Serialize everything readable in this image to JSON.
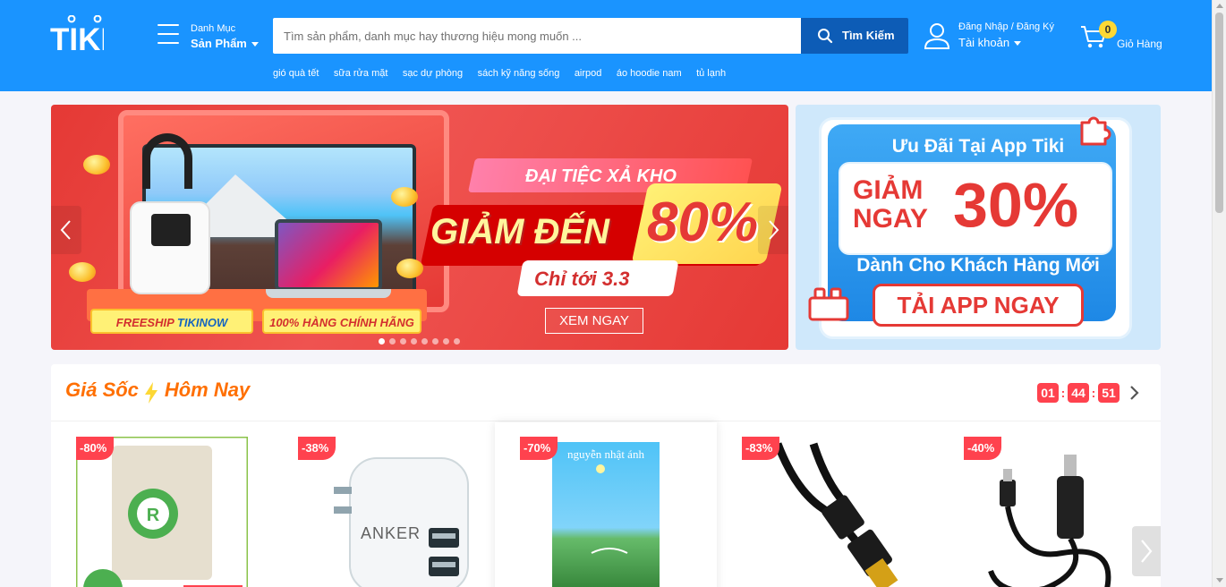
{
  "header": {
    "logo": "TIKI",
    "category": {
      "small": "Danh Mục",
      "big": "Sản Phẩm"
    },
    "search": {
      "placeholder": "Tìm sản phẩm, danh mục hay thương hiệu mong muốn ...",
      "button": "Tìm Kiếm"
    },
    "quick_links": [
      "gió quà tết",
      "sữa rửa mặt",
      "sạc dự phòng",
      "sách kỹ năng sống",
      "airpod",
      "áo hoodie nam",
      "tủ lạnh"
    ],
    "account": {
      "small": "Đăng Nhập / Đăng Ký",
      "big": "Tài khoản"
    },
    "cart": {
      "count": "0",
      "label": "Giỏ Hàng"
    }
  },
  "banner_main": {
    "event": "ĐẠI TIỆC XẢ KHO",
    "headline": "GIẢM ĐẾN",
    "percent": "80%",
    "date": "Chỉ tới 3.3",
    "cta": "XEM NGAY",
    "pill_freeship": "FREESHIP",
    "pill_tiki": "TIKI",
    "pill_now": "NOW",
    "pill_genuine": "100% HÀNG CHÍNH HÃNG",
    "slide_count": 8,
    "active_slide": 1
  },
  "banner_side": {
    "title": "Ưu Đãi Tại App Tiki",
    "giam": "GIẢM",
    "ngay": "NGAY",
    "percent": "30%",
    "subtitle": "Dành Cho Khách Hàng Mới",
    "cta": "TẢI APP NGAY"
  },
  "flash_deal": {
    "title_left": "Giá Sốc",
    "title_right": "Hôm Nay",
    "timer": {
      "hours": "01",
      "minutes": "44",
      "seconds": "51"
    },
    "products": [
      {
        "discount": "-80%",
        "image": "oat-package"
      },
      {
        "discount": "-38%",
        "image": "anker-charger",
        "brand": "ANKER"
      },
      {
        "discount": "-70%",
        "image": "book-cover",
        "author": "nguyễn nhật ánh"
      },
      {
        "discount": "-83%",
        "image": "usb-extension-cable"
      },
      {
        "discount": "-40%",
        "image": "lightning-cable"
      }
    ]
  },
  "colors": {
    "header_bg": "#1a94ff",
    "search_btn": "#0d5cb6",
    "badge_red": "#ff424e",
    "deal_orange": "#ff6f00",
    "cart_badge": "#fdd835"
  }
}
